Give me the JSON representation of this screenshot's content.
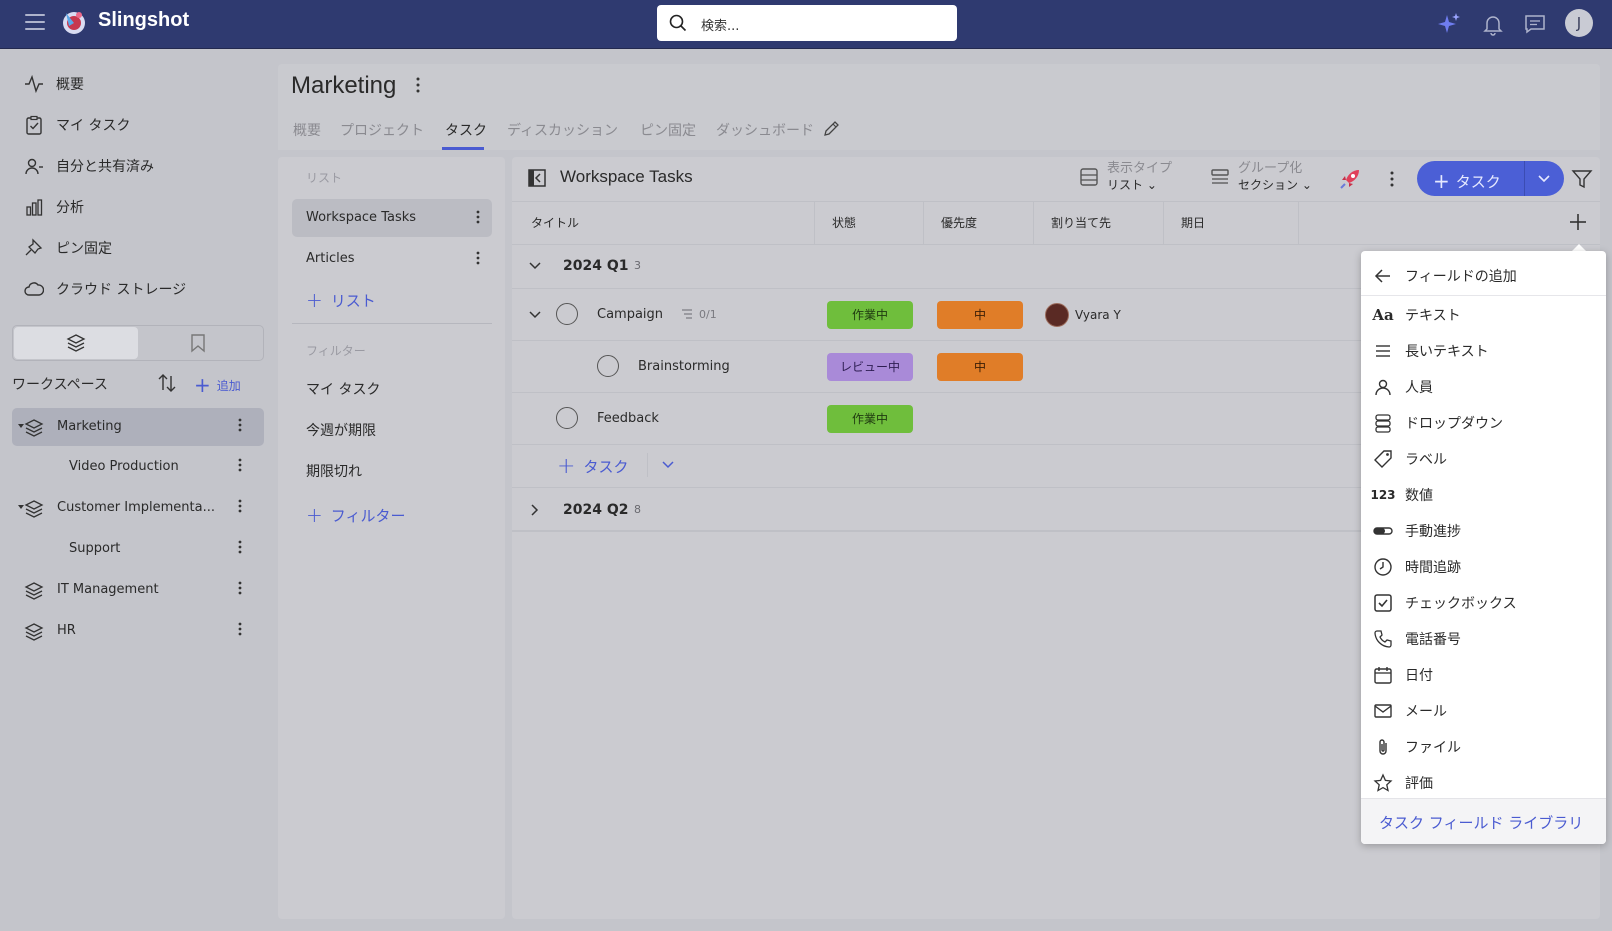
{
  "app": {
    "name": "Slingshot"
  },
  "search": {
    "placeholder": "検索..."
  },
  "user": {
    "initial": "J"
  },
  "nav": {
    "items": [
      {
        "label": "概要",
        "icon": "activity-icon"
      },
      {
        "label": "マイ タスク",
        "icon": "clipboard-check-icon"
      },
      {
        "label": "自分と共有済み",
        "icon": "shared-user-icon"
      },
      {
        "label": "分析",
        "icon": "bar-chart-icon"
      },
      {
        "label": "ピン固定",
        "icon": "pin-icon"
      },
      {
        "label": "クラウド ストレージ",
        "icon": "cloud-icon"
      }
    ]
  },
  "workspaces": {
    "title": "ワークスペース",
    "add_label": "追加",
    "items": [
      {
        "label": "Marketing",
        "active": true
      },
      {
        "label": "Video Production",
        "child": true
      },
      {
        "label": "Customer Implementa..."
      },
      {
        "label": "Support",
        "child": true
      },
      {
        "label": "IT Management"
      },
      {
        "label": "HR"
      }
    ]
  },
  "page": {
    "title": "Marketing",
    "tabs": [
      "概要",
      "プロジェクト",
      "タスク",
      "ディスカッション",
      "ピン固定",
      "ダッシュボード"
    ],
    "active_tab": "タスク"
  },
  "lists": {
    "section_label": "リスト",
    "items": [
      "Workspace Tasks",
      "Articles"
    ],
    "add_label": "リスト",
    "filter_label": "フィルター",
    "filters": [
      "マイ タスク",
      "今週が期限",
      "期限切れ"
    ],
    "add_filter_label": "フィルター"
  },
  "board": {
    "title": "Workspace Tasks",
    "view_type_label": "表示タイプ",
    "view_type_value": "リスト",
    "group_label": "グループ化",
    "group_value": "セクション",
    "add_task_label": "タスク",
    "columns": [
      "タイトル",
      "状態",
      "優先度",
      "割り当て先",
      "期日"
    ],
    "groups": [
      {
        "title": "2024 Q1",
        "count": "3"
      },
      {
        "title": "2024 Q2",
        "count": "8"
      }
    ],
    "tasks": [
      {
        "title": "Campaign",
        "subtasks": "0/1",
        "status": "作業中",
        "priority": "中",
        "assignee": "Vyara Y"
      },
      {
        "title": "Brainstorming",
        "status": "レビュー中",
        "priority": "中"
      },
      {
        "title": "Feedback",
        "status": "作業中"
      }
    ],
    "row_add_label": "タスク"
  },
  "field_menu": {
    "header": "フィールドの追加",
    "items": [
      {
        "label": "テキスト",
        "icon": "text-aa-icon"
      },
      {
        "label": "長いテキスト",
        "icon": "long-text-icon"
      },
      {
        "label": "人員",
        "icon": "person-icon"
      },
      {
        "label": "ドロップダウン",
        "icon": "dropdown-icon"
      },
      {
        "label": "ラベル",
        "icon": "tag-icon"
      },
      {
        "label": "数値",
        "icon": "number-123-icon",
        "glyph": "123"
      },
      {
        "label": "手動進捗",
        "icon": "progress-icon"
      },
      {
        "label": "時間追跡",
        "icon": "clock-icon"
      },
      {
        "label": "チェックボックス",
        "icon": "checkbox-icon"
      },
      {
        "label": "電話番号",
        "icon": "phone-icon"
      },
      {
        "label": "日付",
        "icon": "calendar-icon"
      },
      {
        "label": "メール",
        "icon": "mail-icon"
      },
      {
        "label": "ファイル",
        "icon": "paperclip-icon"
      },
      {
        "label": "評価",
        "icon": "star-icon"
      }
    ],
    "footer": "タスク フィールド ライブラリ"
  },
  "colors": {
    "topbar": "#2f3a70",
    "accent": "#4b5fd6",
    "status_in_progress": "#6fbe3c",
    "status_review": "#a98ad8",
    "priority_medium": "#e07d28"
  }
}
